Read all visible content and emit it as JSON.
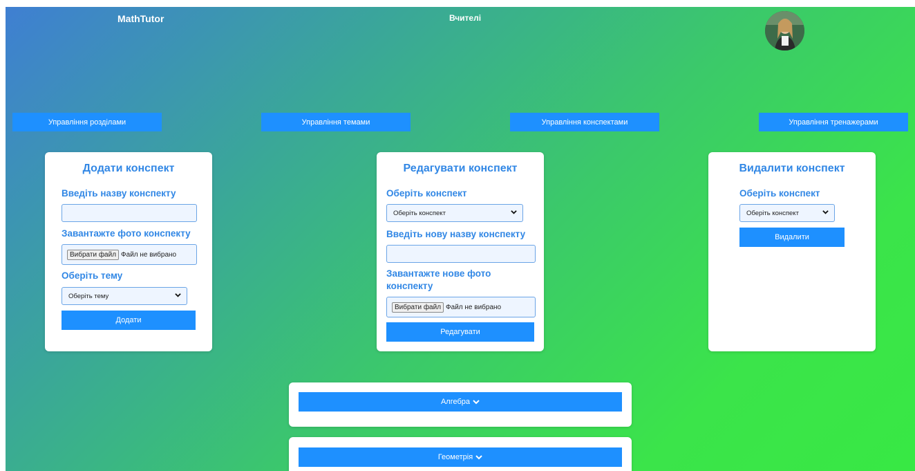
{
  "header": {
    "logo": "MathTutor",
    "teachers_link": "Вчителі"
  },
  "nav": {
    "sections": "Управління розділами",
    "topics": "Управління темами",
    "notes": "Управління конспектами",
    "trainers": "Управління тренажерами"
  },
  "add_card": {
    "title": "Додати конспект",
    "name_label": "Введіть назву конспекту",
    "name_value": "",
    "photo_label": "Завантажте фото конспекту",
    "file_button": "Вибрати файл",
    "file_status": "Файл не вибрано",
    "topic_label": "Оберіть тему",
    "topic_select": "Оберіть тему",
    "submit": "Додати"
  },
  "edit_card": {
    "title": "Редагувати конспект",
    "select_label": "Оберіть конспект",
    "select_value": "Оберіть конспект",
    "new_name_label": "Введіть нову назву конспекту",
    "new_name_value": "",
    "new_photo_label": "Завантажте нове фото конспекту",
    "file_button": "Вибрати файл",
    "file_status": "Файл не вибрано",
    "submit": "Редагувати"
  },
  "delete_card": {
    "title": "Видалити конспект",
    "select_label": "Оберіть конспект",
    "select_value": "Оберіть конспект",
    "submit": "Видалити"
  },
  "accordion": [
    {
      "label": "Алгебра"
    },
    {
      "label": "Геометрія"
    }
  ],
  "colors": {
    "accent": "#1e90ff",
    "heading": "#3187e5",
    "gradient_start": "#3f7fd2",
    "gradient_end": "#38e844"
  },
  "icons": [
    "chevron-down-icon",
    "avatar-photo"
  ]
}
